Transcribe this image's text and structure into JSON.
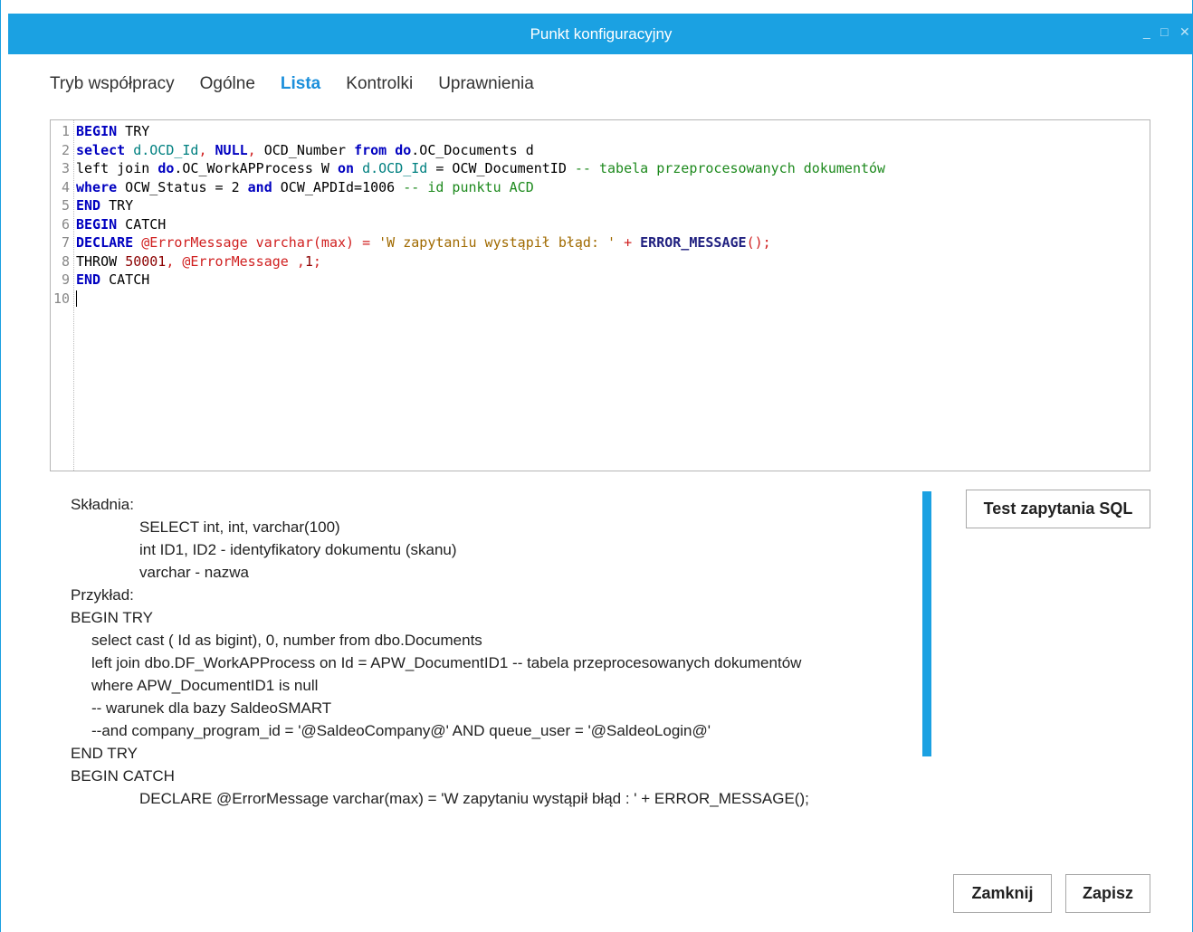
{
  "window": {
    "title": "Punkt konfiguracyjny",
    "controls": {
      "minimize": "_",
      "maximize": "□",
      "close": "✕"
    }
  },
  "tabs": [
    {
      "label": "Tryb współpracy",
      "active": false
    },
    {
      "label": "Ogólne",
      "active": false
    },
    {
      "label": "Lista",
      "active": true
    },
    {
      "label": "Kontrolki",
      "active": false
    },
    {
      "label": "Uprawnienia",
      "active": false
    }
  ],
  "editor": {
    "line_numbers": [
      "1",
      "2",
      "3",
      "4",
      "5",
      "6",
      "7",
      "8",
      "9",
      "10"
    ],
    "lines": [
      [
        {
          "t": "BEGIN",
          "c": "kw"
        },
        {
          "t": " TRY",
          "c": ""
        }
      ],
      [
        {
          "t": "select",
          "c": "kw"
        },
        {
          "t": " d.OCD_Id",
          "c": "obj"
        },
        {
          "t": ", ",
          "c": "var"
        },
        {
          "t": "NULL",
          "c": "kw"
        },
        {
          "t": ", ",
          "c": "var"
        },
        {
          "t": "OCD_Number ",
          "c": ""
        },
        {
          "t": "from",
          "c": "kw"
        },
        {
          "t": " ",
          "c": ""
        },
        {
          "t": "do",
          "c": "kw"
        },
        {
          "t": ".OC_Documents d",
          "c": ""
        }
      ],
      [
        {
          "t": "left join ",
          "c": ""
        },
        {
          "t": "do",
          "c": "kw"
        },
        {
          "t": ".OC_WorkAPProcess W ",
          "c": ""
        },
        {
          "t": "on",
          "c": "kw"
        },
        {
          "t": " d.OCD_Id",
          "c": "obj"
        },
        {
          "t": " = OCW_DocumentID ",
          "c": ""
        },
        {
          "t": "-- tabela przeprocesowanych dokumentów",
          "c": "cm"
        }
      ],
      [
        {
          "t": "where",
          "c": "kw"
        },
        {
          "t": " OCW_Status = 2 ",
          "c": ""
        },
        {
          "t": "and",
          "c": "kw"
        },
        {
          "t": " OCW_APDId=1006 ",
          "c": ""
        },
        {
          "t": "-- id punktu ACD",
          "c": "cm"
        }
      ],
      [
        {
          "t": "END",
          "c": "kw"
        },
        {
          "t": " TRY",
          "c": ""
        }
      ],
      [
        {
          "t": "BEGIN",
          "c": "kw"
        },
        {
          "t": " CATCH",
          "c": ""
        }
      ],
      [
        {
          "t": "DECLARE",
          "c": "kw"
        },
        {
          "t": " @ErrorMessage varchar(max) = ",
          "c": "var"
        },
        {
          "t": "'W zapytaniu wystąpił błąd: '",
          "c": "str"
        },
        {
          "t": " + ",
          "c": "var"
        },
        {
          "t": "ERROR_MESSAGE",
          "c": "fn"
        },
        {
          "t": "();",
          "c": "var"
        }
      ],
      [
        {
          "t": "THROW ",
          "c": ""
        },
        {
          "t": "50001",
          "c": "num"
        },
        {
          "t": ", @ErrorMessage ,",
          "c": "var"
        },
        {
          "t": "1",
          "c": "num"
        },
        {
          "t": ";",
          "c": "var"
        }
      ],
      [
        {
          "t": "END",
          "c": "kw"
        },
        {
          "t": " CATCH",
          "c": ""
        }
      ],
      []
    ]
  },
  "help_lines": [
    {
      "text": "Składnia:",
      "indent": 0
    },
    {
      "text": "SELECT int, int, varchar(100)",
      "indent": 2
    },
    {
      "text": "int ID1, ID2 - identyfikatory dokumentu (skanu)",
      "indent": 2
    },
    {
      "text": "varchar - nazwa",
      "indent": 2
    },
    {
      "text": "Przykład:",
      "indent": 0
    },
    {
      "text": "BEGIN TRY",
      "indent": 0
    },
    {
      "text": "select cast ( Id as bigint), 0, number from dbo.Documents",
      "indent": 1
    },
    {
      "text": "left join dbo.DF_WorkAPProcess on Id = APW_DocumentID1 -- tabela przeprocesowanych dokumentów",
      "indent": 1
    },
    {
      "text": "where APW_DocumentID1 is null",
      "indent": 1
    },
    {
      "text": "-- warunek dla bazy SaldeoSMART",
      "indent": 1
    },
    {
      "text": "--and company_program_id = '@SaldeoCompany@' AND queue_user = '@SaldeoLogin@'",
      "indent": 1
    },
    {
      "text": "END TRY",
      "indent": 0
    },
    {
      "text": "BEGIN CATCH",
      "indent": 0
    },
    {
      "text": "DECLARE @ErrorMessage varchar(max) = 'W zapytaniu wystąpił błąd : ' + ERROR_MESSAGE();",
      "indent": 2
    }
  ],
  "buttons": {
    "test_sql": "Test zapytania SQL",
    "close": "Zamknij",
    "save": "Zapisz"
  },
  "colors": {
    "accent": "#1ba1e2",
    "active_tab": "#1b8fdb"
  }
}
